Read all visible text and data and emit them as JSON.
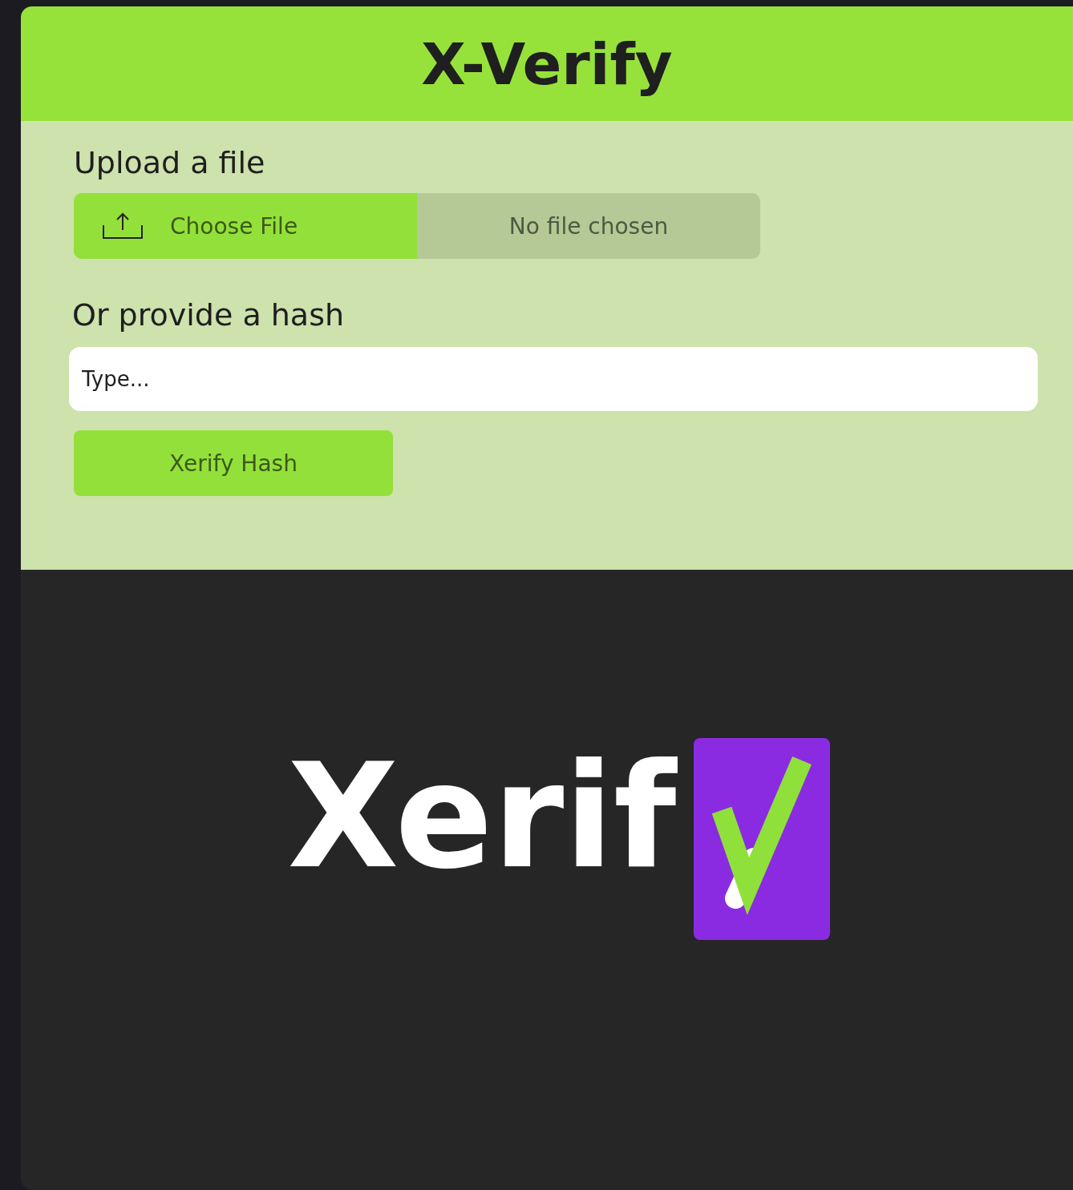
{
  "header": {
    "title": "X-Verify"
  },
  "upload": {
    "heading": "Upload a file",
    "button": "Choose File",
    "status": "No file chosen"
  },
  "hash": {
    "heading": "Or provide a hash",
    "placeholder": "Type...",
    "button": "Xerify Hash"
  },
  "logo": {
    "text": "Xerif"
  }
}
